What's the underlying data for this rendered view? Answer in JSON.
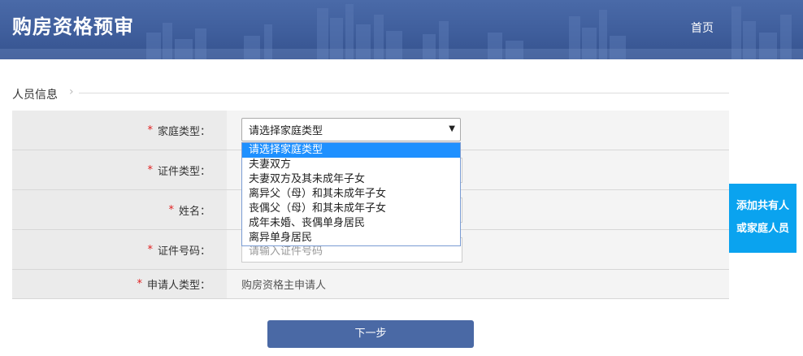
{
  "header": {
    "title": "购房资格预审",
    "home_link": "首页"
  },
  "section": {
    "title": "人员信息"
  },
  "form": {
    "rows": [
      {
        "label": "家庭类型：",
        "required": "*",
        "value": "请选择家庭类型"
      },
      {
        "label": "证件类型：",
        "required": "*",
        "value": ""
      },
      {
        "label": "姓名：",
        "required": "*",
        "value": ""
      },
      {
        "label": "证件号码：",
        "required": "*",
        "placeholder": "请输入证件号码"
      },
      {
        "label": "申请人类型：",
        "required": "*",
        "value": "购房资格主申请人"
      }
    ]
  },
  "dropdown": {
    "options": [
      "请选择家庭类型",
      "夫妻双方",
      "夫妻双方及其未成年子女",
      "离异父（母）和其未成年子女",
      "丧偶父（母）和其未成年子女",
      "成年未婚、丧偶单身居民",
      "离异单身居民"
    ],
    "selected_index": 0
  },
  "side_button": {
    "line1": "添加共有人",
    "line2": "或家庭人员"
  },
  "next_button": {
    "label": "下一步"
  },
  "colors": {
    "header_bg": "#3f5e9c",
    "accent_blue": "#0aa3ef",
    "button_blue": "#4a69a5",
    "required_red": "#e02020",
    "selected_option": "#1e90ff"
  }
}
